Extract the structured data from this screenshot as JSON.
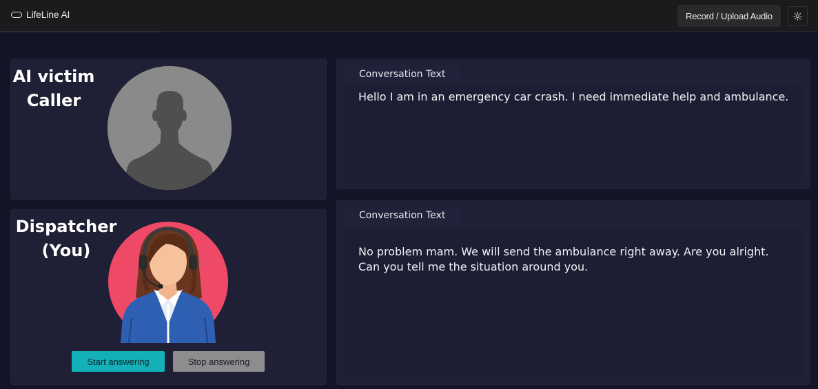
{
  "header": {
    "app_name": "LifeLine AI",
    "record_button_label": "Record / Upload Audio",
    "theme_icon": "sun-icon"
  },
  "caller": {
    "title_line1": "AI victim",
    "title_line2": "Caller",
    "avatar_icon": "person-silhouette-icon"
  },
  "dispatcher": {
    "title_line1": "Dispatcher",
    "title_line2": "(You)",
    "avatar_icon": "operator-headset-avatar",
    "start_button_label": "Start answering",
    "stop_button_label": "Stop answering"
  },
  "conversations": [
    {
      "label": "Conversation Text",
      "text": "Hello I am in an emergency car crash. I need immediate help and ambulance."
    },
    {
      "label": "Conversation Text",
      "text": "No problem mam. We will send the ambulance right away. Are you alright. Can you tell me the situation around you."
    }
  ],
  "colors": {
    "page_background": "#131425",
    "topbar_background": "#1b1b1d",
    "card_background": "#1f1f35",
    "start_button": "#14b0b8",
    "stop_button": "#8d8d8f",
    "dispatcher_avatar_background": "#ee4a68"
  }
}
